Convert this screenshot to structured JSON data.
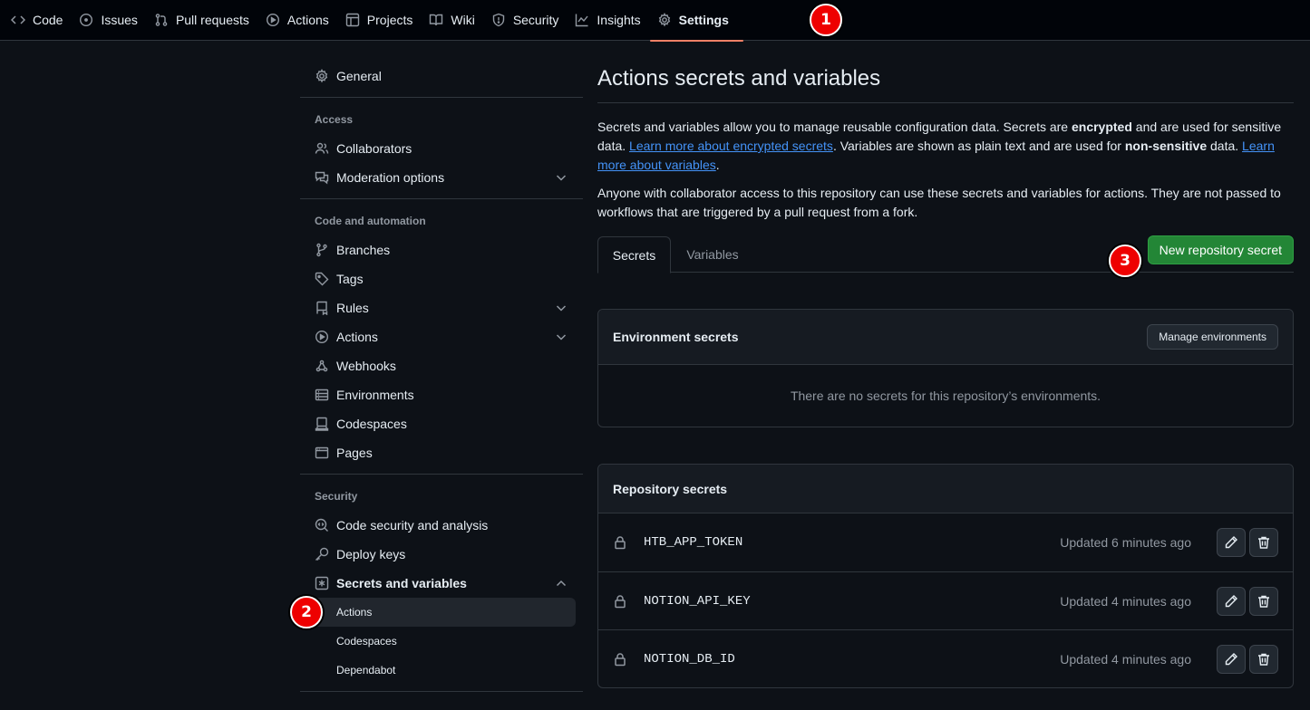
{
  "topnav": {
    "tabs": [
      {
        "label": "Code",
        "icon": "code-icon"
      },
      {
        "label": "Issues",
        "icon": "issue-opened-icon"
      },
      {
        "label": "Pull requests",
        "icon": "git-pull-request-icon"
      },
      {
        "label": "Actions",
        "icon": "play-icon"
      },
      {
        "label": "Projects",
        "icon": "table-icon"
      },
      {
        "label": "Wiki",
        "icon": "book-icon"
      },
      {
        "label": "Security",
        "icon": "shield-icon"
      },
      {
        "label": "Insights",
        "icon": "graph-icon"
      },
      {
        "label": "Settings",
        "icon": "gear-icon",
        "active": true
      }
    ]
  },
  "badges": {
    "one": "1",
    "two": "2",
    "three": "3"
  },
  "sidebar": {
    "general": "General",
    "access_heading": "Access",
    "collaborators": "Collaborators",
    "moderation": "Moderation options",
    "code_heading": "Code and automation",
    "branches": "Branches",
    "tags": "Tags",
    "rules": "Rules",
    "actions": "Actions",
    "webhooks": "Webhooks",
    "environments": "Environments",
    "codespaces": "Codespaces",
    "pages": "Pages",
    "security_heading": "Security",
    "code_security": "Code security and analysis",
    "deploy_keys": "Deploy keys",
    "secrets": "Secrets and variables",
    "sub_actions": "Actions",
    "sub_codespaces": "Codespaces",
    "sub_dependabot": "Dependabot"
  },
  "main": {
    "title": "Actions secrets and variables",
    "desc1_a": "Secrets and variables allow you to manage reusable configuration data. Secrets are ",
    "desc1_b": "encrypted",
    "desc1_c": " and are used for sensitive data. ",
    "desc1_link1": "Learn more about encrypted secrets",
    "desc1_d": ". Variables are shown as plain text and are used for ",
    "desc1_e": "non-sensitive",
    "desc1_f": " data. ",
    "desc1_link2": "Learn more about variables",
    "desc1_g": ".",
    "desc2": "Anyone with collaborator access to this repository can use these secrets and variables for actions. They are not passed to workflows that are triggered by a pull request from a fork.",
    "tab_secrets": "Secrets",
    "tab_variables": "Variables",
    "new_secret_btn": "New repository secret",
    "env_title": "Environment secrets",
    "manage_env_btn": "Manage environments",
    "env_empty": "There are no secrets for this repository’s environments.",
    "repo_title": "Repository secrets",
    "secrets": [
      {
        "name": "HTB_APP_TOKEN",
        "updated": "Updated 6 minutes ago"
      },
      {
        "name": "NOTION_API_KEY",
        "updated": "Updated 4 minutes ago"
      },
      {
        "name": "NOTION_DB_ID",
        "updated": "Updated 4 minutes ago"
      }
    ]
  },
  "colors": {
    "accent_tab": "#f78166",
    "primary_button": "#238636",
    "link": "#4493f8",
    "badge": "#ee0000"
  }
}
